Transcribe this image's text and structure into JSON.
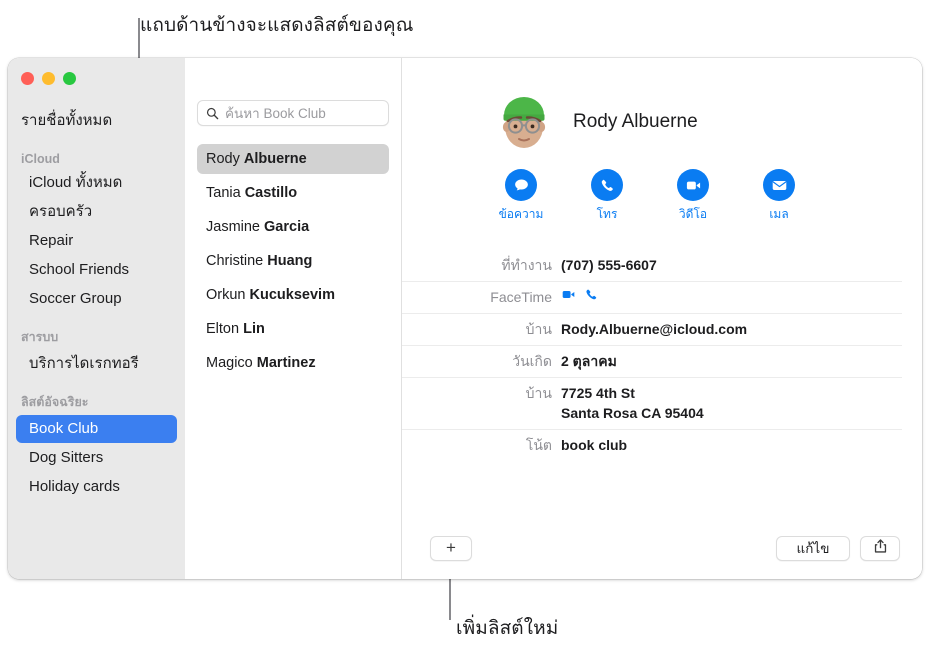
{
  "annotations": {
    "top": "แถบด้านข้างจะแสดงลิสต์ของคุณ",
    "bottom": "เพิ่มลิสต์ใหม่"
  },
  "window": {
    "traffic_lights": {
      "close": "close-button",
      "minimize": "minimize-button",
      "zoom": "zoom-button",
      "close_color": "#ff5f57",
      "minimize_color": "#febc2e",
      "zoom_color": "#28c840"
    }
  },
  "sidebar": {
    "all_contacts": "รายชื่อทั้งหมด",
    "accent_color": "#3b7ff0",
    "sections": [
      {
        "header": "iCloud",
        "items": [
          {
            "label": "iCloud ทั้งหมด",
            "selected": false
          },
          {
            "label": "ครอบครัว",
            "selected": false
          },
          {
            "label": "Repair",
            "selected": false
          },
          {
            "label": "School Friends",
            "selected": false
          },
          {
            "label": "Soccer Group",
            "selected": false
          }
        ]
      },
      {
        "header": "สารบบ",
        "items": [
          {
            "label": "บริการไดเรกทอรี",
            "selected": false
          }
        ]
      },
      {
        "header": "ลิสต์อัจฉริยะ",
        "items": [
          {
            "label": "Book Club",
            "selected": true
          },
          {
            "label": "Dog Sitters",
            "selected": false
          },
          {
            "label": "Holiday cards",
            "selected": false
          }
        ]
      }
    ]
  },
  "contact_list": {
    "search": {
      "placeholder": "ค้นหา Book Club",
      "value": "",
      "icon": "search-icon"
    },
    "contacts": [
      {
        "first": "Rody",
        "last": "Albuerne",
        "selected": true
      },
      {
        "first": "Tania",
        "last": "Castillo",
        "selected": false
      },
      {
        "first": "Jasmine",
        "last": "Garcia",
        "selected": false
      },
      {
        "first": "Christine",
        "last": "Huang",
        "selected": false
      },
      {
        "first": "Orkun",
        "last": "Kucuksevim",
        "selected": false
      },
      {
        "first": "Elton",
        "last": "Lin",
        "selected": false
      },
      {
        "first": "Magico",
        "last": "Martinez",
        "selected": false
      }
    ]
  },
  "detail": {
    "name": "Rody Albuerne",
    "avatar": "memoji-avatar",
    "action_color": "#0a7cf2",
    "actions": [
      {
        "label": "ข้อความ",
        "icon": "message-icon"
      },
      {
        "label": "โทร",
        "icon": "phone-icon"
      },
      {
        "label": "วิดีโอ",
        "icon": "video-icon"
      },
      {
        "label": "เมล",
        "icon": "mail-icon"
      }
    ],
    "fields": [
      {
        "label": "ที่ทำงาน",
        "value": "(707) 555-6607",
        "type": "text"
      },
      {
        "label": "FaceTime",
        "value": "",
        "type": "icons",
        "icons": [
          "video-icon",
          "phone-icon"
        ]
      },
      {
        "label": "บ้าน",
        "value": "Rody.Albuerne@icloud.com",
        "type": "text"
      },
      {
        "label": "วันเกิด",
        "value": "2 ตุลาคม",
        "type": "text"
      },
      {
        "label": "บ้าน",
        "value": "",
        "type": "address",
        "lines": [
          "7725 4th St",
          "Santa Rosa CA 95404"
        ]
      },
      {
        "label": "โน้ต",
        "value": "book club",
        "type": "text"
      }
    ]
  },
  "toolbar": {
    "add_label": "+",
    "edit_label": "แก้ไข",
    "share_icon": "share-icon"
  }
}
